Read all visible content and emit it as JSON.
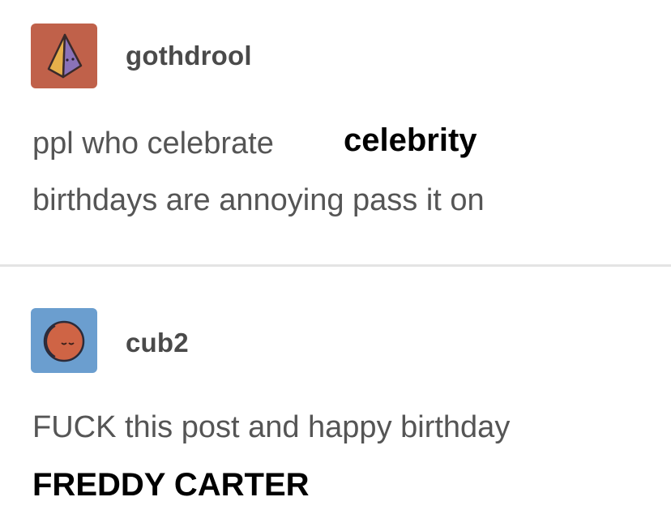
{
  "posts": [
    {
      "username": "gothdrool",
      "avatar_icon": "pyramid-avatar-icon",
      "avatar_bg": "#c0614a",
      "body_line_1": "ppl who celebrate",
      "overlay_word": "celebrity",
      "body_line_2": "birthdays are annoying pass it on"
    },
    {
      "username": "cub2",
      "avatar_icon": "moon-face-avatar-icon",
      "avatar_bg": "#6b9ecf",
      "body_line_1": "FUCK this post and happy birthday",
      "overlay_text": "FREDDY CARTER"
    }
  ]
}
